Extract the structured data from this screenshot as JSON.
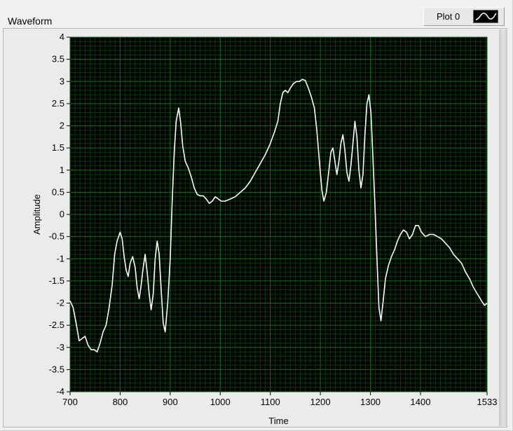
{
  "panel": {
    "title": "Waveform",
    "legend_label": "Plot 0"
  },
  "chart_data": {
    "type": "line",
    "title": "Waveform",
    "xlabel": "Time",
    "ylabel": "Amplitude",
    "xlim": [
      700,
      1533
    ],
    "ylim": [
      -4,
      4
    ],
    "x_ticks": [
      700,
      800,
      900,
      1000,
      1100,
      1200,
      1300,
      1400,
      1533
    ],
    "y_ticks": [
      -4,
      -3.5,
      -3,
      -2.5,
      -2,
      -1.5,
      -1,
      -0.5,
      0,
      0.5,
      1,
      1.5,
      2,
      2.5,
      3,
      3.5,
      4
    ],
    "grid": true,
    "legend": "top-right",
    "colors": {
      "plot_bg": "#000000",
      "grid": "#0b6b12",
      "minor_grid": "#053b0a",
      "line": "#ffffff"
    },
    "series": [
      {
        "name": "Plot 0",
        "points": [
          [
            700,
            -1.95
          ],
          [
            706,
            -2.1
          ],
          [
            712,
            -2.45
          ],
          [
            718,
            -2.85
          ],
          [
            724,
            -2.8
          ],
          [
            730,
            -2.75
          ],
          [
            736,
            -2.95
          ],
          [
            742,
            -3.05
          ],
          [
            748,
            -3.05
          ],
          [
            754,
            -3.1
          ],
          [
            760,
            -2.9
          ],
          [
            766,
            -2.65
          ],
          [
            772,
            -2.5
          ],
          [
            778,
            -2.1
          ],
          [
            784,
            -1.6
          ],
          [
            789,
            -0.9
          ],
          [
            794,
            -0.6
          ],
          [
            800,
            -0.4
          ],
          [
            804,
            -0.55
          ],
          [
            808,
            -0.95
          ],
          [
            812,
            -1.25
          ],
          [
            816,
            -1.4
          ],
          [
            820,
            -1.1
          ],
          [
            825,
            -0.95
          ],
          [
            830,
            -1.2
          ],
          [
            834,
            -1.65
          ],
          [
            838,
            -1.9
          ],
          [
            842,
            -1.6
          ],
          [
            846,
            -1.2
          ],
          [
            850,
            -0.9
          ],
          [
            854,
            -1.3
          ],
          [
            858,
            -1.8
          ],
          [
            862,
            -2.15
          ],
          [
            866,
            -1.8
          ],
          [
            870,
            -1.0
          ],
          [
            874,
            -0.6
          ],
          [
            878,
            -0.9
          ],
          [
            882,
            -1.7
          ],
          [
            886,
            -2.45
          ],
          [
            890,
            -2.65
          ],
          [
            895,
            -2.0
          ],
          [
            900,
            -1.0
          ],
          [
            904,
            0.3
          ],
          [
            908,
            1.4
          ],
          [
            912,
            2.1
          ],
          [
            917,
            2.4
          ],
          [
            921,
            2.05
          ],
          [
            925,
            1.55
          ],
          [
            930,
            1.2
          ],
          [
            936,
            1.05
          ],
          [
            942,
            0.85
          ],
          [
            948,
            0.6
          ],
          [
            954,
            0.45
          ],
          [
            960,
            0.42
          ],
          [
            966,
            0.42
          ],
          [
            972,
            0.35
          ],
          [
            978,
            0.25
          ],
          [
            984,
            0.3
          ],
          [
            990,
            0.4
          ],
          [
            996,
            0.35
          ],
          [
            1002,
            0.3
          ],
          [
            1010,
            0.3
          ],
          [
            1020,
            0.35
          ],
          [
            1030,
            0.4
          ],
          [
            1040,
            0.5
          ],
          [
            1050,
            0.6
          ],
          [
            1060,
            0.75
          ],
          [
            1070,
            0.95
          ],
          [
            1080,
            1.15
          ],
          [
            1090,
            1.35
          ],
          [
            1100,
            1.6
          ],
          [
            1108,
            1.85
          ],
          [
            1115,
            2.1
          ],
          [
            1120,
            2.5
          ],
          [
            1125,
            2.75
          ],
          [
            1130,
            2.8
          ],
          [
            1135,
            2.75
          ],
          [
            1140,
            2.85
          ],
          [
            1146,
            2.95
          ],
          [
            1152,
            3.0
          ],
          [
            1158,
            3.0
          ],
          [
            1164,
            3.05
          ],
          [
            1170,
            3.02
          ],
          [
            1176,
            2.85
          ],
          [
            1182,
            2.65
          ],
          [
            1188,
            2.4
          ],
          [
            1193,
            1.9
          ],
          [
            1198,
            1.2
          ],
          [
            1203,
            0.55
          ],
          [
            1207,
            0.3
          ],
          [
            1212,
            0.5
          ],
          [
            1217,
            1.0
          ],
          [
            1221,
            1.4
          ],
          [
            1225,
            1.5
          ],
          [
            1229,
            1.2
          ],
          [
            1233,
            0.9
          ],
          [
            1237,
            1.2
          ],
          [
            1241,
            1.6
          ],
          [
            1245,
            1.8
          ],
          [
            1249,
            1.45
          ],
          [
            1253,
            0.95
          ],
          [
            1257,
            0.75
          ],
          [
            1261,
            1.1
          ],
          [
            1265,
            1.6
          ],
          [
            1269,
            2.1
          ],
          [
            1273,
            1.75
          ],
          [
            1277,
            1.0
          ],
          [
            1281,
            0.6
          ],
          [
            1285,
            0.9
          ],
          [
            1289,
            1.8
          ],
          [
            1293,
            2.5
          ],
          [
            1297,
            2.7
          ],
          [
            1301,
            2.3
          ],
          [
            1305,
            1.3
          ],
          [
            1309,
            0.2
          ],
          [
            1313,
            -1.0
          ],
          [
            1317,
            -2.1
          ],
          [
            1321,
            -2.4
          ],
          [
            1325,
            -2.0
          ],
          [
            1330,
            -1.45
          ],
          [
            1336,
            -1.15
          ],
          [
            1342,
            -0.95
          ],
          [
            1348,
            -0.8
          ],
          [
            1354,
            -0.6
          ],
          [
            1360,
            -0.45
          ],
          [
            1366,
            -0.35
          ],
          [
            1372,
            -0.4
          ],
          [
            1378,
            -0.55
          ],
          [
            1384,
            -0.45
          ],
          [
            1390,
            -0.25
          ],
          [
            1396,
            -0.25
          ],
          [
            1402,
            -0.4
          ],
          [
            1410,
            -0.5
          ],
          [
            1418,
            -0.45
          ],
          [
            1426,
            -0.45
          ],
          [
            1434,
            -0.5
          ],
          [
            1442,
            -0.55
          ],
          [
            1450,
            -0.65
          ],
          [
            1458,
            -0.75
          ],
          [
            1466,
            -0.9
          ],
          [
            1474,
            -1.0
          ],
          [
            1482,
            -1.1
          ],
          [
            1490,
            -1.3
          ],
          [
            1498,
            -1.45
          ],
          [
            1506,
            -1.65
          ],
          [
            1514,
            -1.8
          ],
          [
            1522,
            -1.95
          ],
          [
            1528,
            -2.05
          ],
          [
            1533,
            -2.0
          ]
        ]
      }
    ]
  }
}
